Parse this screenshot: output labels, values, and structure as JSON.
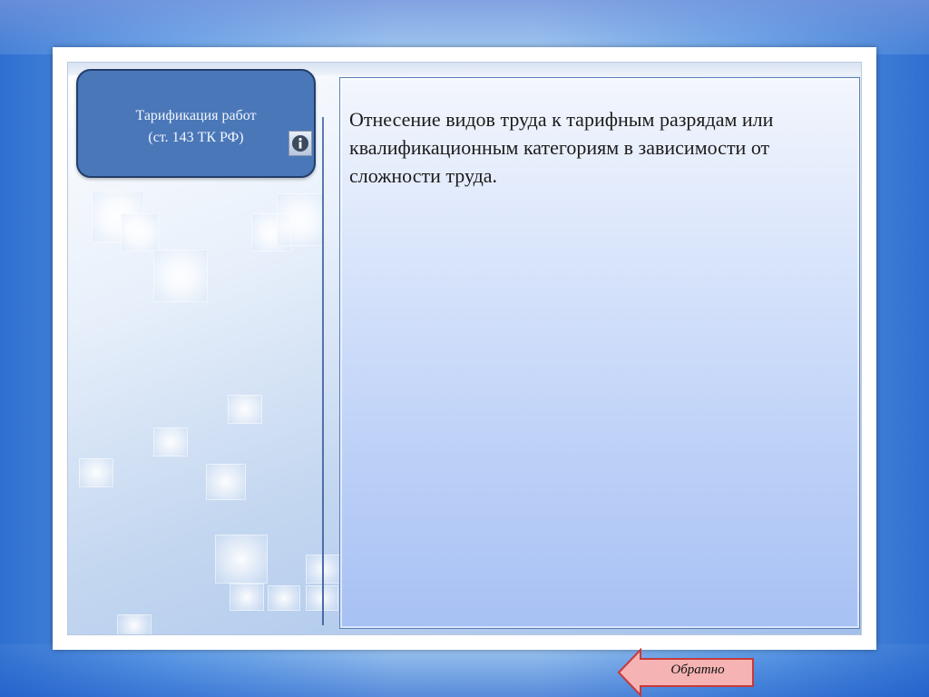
{
  "slide": {
    "title_line1": "Тарификация работ",
    "title_line2": "(ст. 143 ТК РФ)",
    "content": "Отнесение видов труда к тарифным разрядам или квалификационным категориям в зависимости от сложности труда.",
    "back_label": "Обратно",
    "info_icon": "info-icon",
    "back_icon": "arrow-left-icon"
  },
  "colors": {
    "title_box": "#4a77b8",
    "title_border": "#233e6b",
    "back_button": "#f6b3b3",
    "back_border": "#c73a3a"
  }
}
